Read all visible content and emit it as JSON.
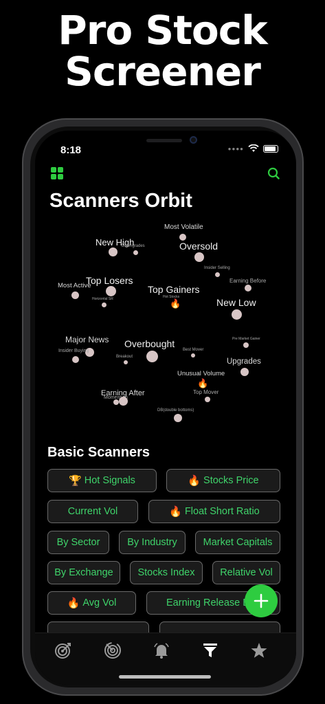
{
  "promo": {
    "line1": "Pro Stock",
    "line2": "Screener"
  },
  "status": {
    "time": "8:18"
  },
  "header": {
    "left_icon": "apps-grid-icon",
    "right_icon": "search-icon",
    "accent": "#2ecc40"
  },
  "page_title": "Scanners Orbit",
  "orbit": {
    "labels": {
      "most_volatile": "Most Volatile",
      "new_high": "New High",
      "downgrades": "Downgrades",
      "oversold": "Oversold",
      "insider_selling": "Insider Selling",
      "top_losers": "Top Losers",
      "most_active": "Most Active",
      "horizontal": "Horizontal SR",
      "top_gainers": "Top Gainers",
      "hot_stocks": "Hot Stocks",
      "earning_before": "Earning Before",
      "new_low": "New Low",
      "major_news": "Major News",
      "insider_buying": "Insider Buying",
      "overbought": "Overbought",
      "breakout": "Breakout",
      "best_mover": "Best Mover",
      "pre_market_gainer": "Pre Market Gainer",
      "upgrades": "Upgrades",
      "unusual_volume": "Unusual Volume",
      "earning_after": "Earning After",
      "momentum": "Momentum",
      "top_mover": "Top Mover",
      "double_bottoms": "DB(double bottoms)"
    }
  },
  "basic": {
    "title": "Basic Scanners",
    "chips": {
      "hot_signals": "Hot Signals",
      "stocks_price": "Stocks Price",
      "current_vol": "Current Vol",
      "float_short_ratio": "Float Short Ratio",
      "by_sector": "By Sector",
      "by_industry": "By Industry",
      "market_capitals": "Market Capitals",
      "by_exchange": "By Exchange",
      "stocks_index": "Stocks Index",
      "relative_vol": "Relative Vol",
      "avg_vol": "Avg Vol",
      "earning_release": "Earning Release D"
    }
  },
  "tabbar": {
    "tabs": [
      "target-icon",
      "radar-icon",
      "bell-icon",
      "filter-icon",
      "star-icon"
    ],
    "active": "filter-icon"
  }
}
